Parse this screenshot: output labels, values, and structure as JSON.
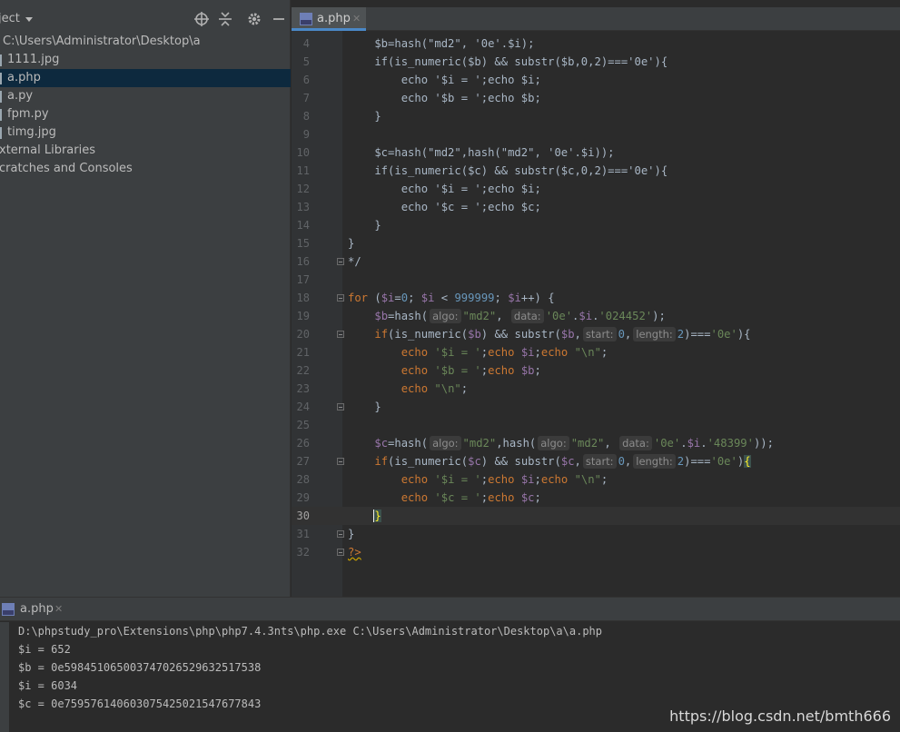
{
  "project": {
    "title": "ject",
    "path": "C:\\Users\\Administrator\\Desktop\\a",
    "files": [
      {
        "name": "1111.jpg",
        "selected": false
      },
      {
        "name": "a.php",
        "selected": true
      },
      {
        "name": "a.py",
        "selected": false
      },
      {
        "name": "fpm.py",
        "selected": false
      },
      {
        "name": "timg.jpg",
        "selected": false
      }
    ],
    "external_libraries": "xternal Libraries",
    "scratches": "cratches and Consoles"
  },
  "editor": {
    "tab_label": "a.php",
    "current_line": "30",
    "line_numbers": [
      "4",
      "5",
      "6",
      "7",
      "8",
      "9",
      "10",
      "11",
      "12",
      "13",
      "14",
      "15",
      "16",
      "17",
      "18",
      "19",
      "20",
      "21",
      "22",
      "23",
      "24",
      "25",
      "26",
      "27",
      "28",
      "29",
      "30",
      "31",
      "32"
    ],
    "hints": {
      "algo": "algo:",
      "data": "data:",
      "start": "start:",
      "length": "length:"
    }
  },
  "run": {
    "tab_label": "a.php",
    "output": [
      "D:\\phpstudy_pro\\Extensions\\php\\php7.4.3nts\\php.exe C:\\Users\\Administrator\\Desktop\\a\\a.php",
      "$i = 652",
      "$b = 0e598451065003747026529632517538",
      "$i = 6034",
      "$c = 0e759576140603075425021547677843"
    ]
  },
  "watermark": "https://blog.csdn.net/bmth666",
  "icons": {
    "locate": "crosshair-icon",
    "collapse": "collapse-all-icon",
    "settings": "gear-icon",
    "hide": "minimize-icon",
    "file": "php-file-icon",
    "close": "close-icon"
  },
  "colors": {
    "background": "#2b2b2b",
    "panel": "#3c3f41",
    "keyword": "#cc7832",
    "variable": "#9876aa",
    "string": "#6a8759",
    "number": "#6897bb",
    "selection": "#0d293e"
  }
}
